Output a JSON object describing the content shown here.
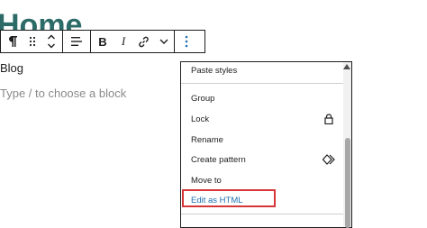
{
  "page": {
    "heading": "Home",
    "block_label": "Blog",
    "placeholder": "Type / to choose a block"
  },
  "toolbar": {
    "paragraph_icon": "paragraph-icon",
    "drag_icon": "drag-handle-icon",
    "move_icon": "move-up-down-icon",
    "align_icon": "align-icon",
    "bold_label": "B",
    "italic_label": "I",
    "link_icon": "link-icon",
    "more_formats_icon": "chevron-down-icon",
    "options_icon": "vertical-ellipsis-icon"
  },
  "menu": {
    "items": [
      {
        "label": "Paste styles"
      },
      {
        "label": "Group"
      },
      {
        "label": "Lock",
        "icon": "lock-icon"
      },
      {
        "label": "Rename"
      },
      {
        "label": "Create pattern",
        "icon": "pattern-icon"
      },
      {
        "label": "Move to"
      },
      {
        "label": "Edit as HTML",
        "highlighted": true
      }
    ]
  },
  "colors": {
    "heading": "#2c6b67",
    "highlight_link": "#2271b1",
    "annotation_box": "#d63638"
  }
}
